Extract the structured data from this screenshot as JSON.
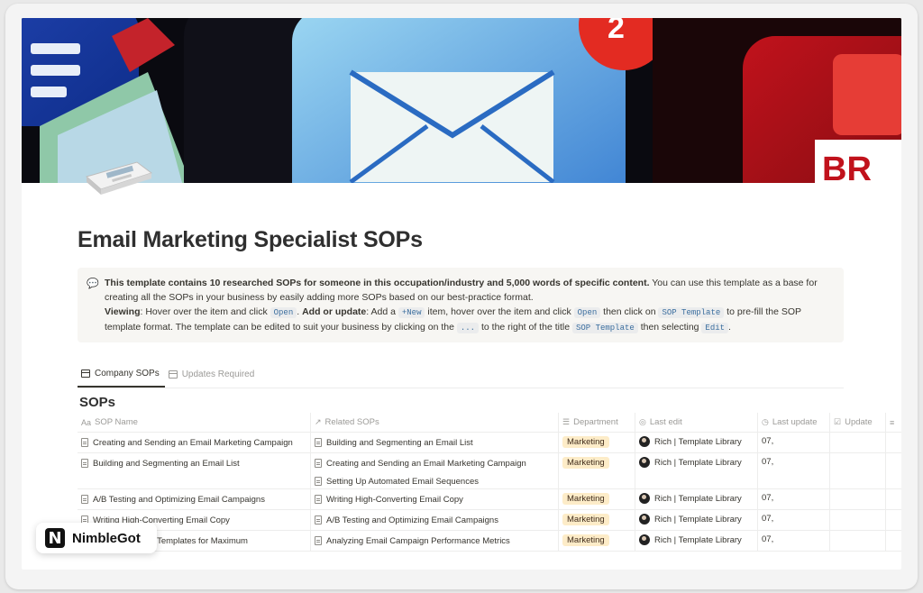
{
  "page": {
    "title": "Email Marketing Specialist SOPs"
  },
  "callout": {
    "icon": "speech-bubble-icon",
    "bold_intro": "This template contains 10 researched SOPs for someone in this occupation/industry and 5,000 words of specific content.",
    "intro_rest": " You can use this template as a base for creating all the SOPs in your business by easily adding more SOPs based on our best-practice format.",
    "viewing_label": "Viewing",
    "viewing_text": ": Hover over the item and click ",
    "open_code": "Open",
    "period1": ". ",
    "add_label": "Add or update",
    "add_text": ": Add a ",
    "new_code": "+New",
    "add_text2": " item, hover over the item and click ",
    "open_code2": "Open",
    "add_text3": " then click on ",
    "sop_template_code": "SOP Template",
    "add_text4": " to pre-fill the SOP template format. The template can be edited to suit your business by clicking on the ",
    "dots_code": "...",
    "add_text5": " to the right of the title ",
    "sop_template_code2": "SOP Template",
    "add_text6": " then selecting ",
    "edit_code": "Edit",
    "period2": "."
  },
  "tabs": [
    {
      "label": "Company SOPs",
      "active": true
    },
    {
      "label": "Updates Required",
      "active": false
    }
  ],
  "database": {
    "title": "SOPs",
    "columns": {
      "name": "SOP Name",
      "name_icon": "Aa",
      "related": "Related SOPs",
      "related_icon": "↗",
      "department": "Department",
      "department_icon": "☰",
      "last_edit": "Last edit",
      "last_edit_icon": "◎",
      "last_update": "Last update",
      "last_update_icon": "◷",
      "update": "Update",
      "update_icon": "☑",
      "more_icon": "≡"
    },
    "rows": [
      {
        "name": "Creating and Sending an Email Marketing Campaign",
        "related": [
          "Building and Segmenting an Email List"
        ],
        "department": "Marketing",
        "last_edit": "Rich | Template Library",
        "last_update": "07,"
      },
      {
        "name": "Building and Segmenting an Email List",
        "related": [
          "Creating and Sending an Email Marketing Campaign",
          "Setting Up Automated Email Sequences"
        ],
        "department": "Marketing",
        "last_edit": "Rich | Template Library",
        "last_update": "07,"
      },
      {
        "name": "A/B Testing and Optimizing Email Campaigns",
        "related": [
          "Writing High-Converting Email Copy"
        ],
        "department": "Marketing",
        "last_edit": "Rich | Template Library",
        "last_update": "07,"
      },
      {
        "name": "Writing High-Converting Email Copy",
        "related": [
          "A/B Testing and Optimizing Email Campaigns"
        ],
        "department": "Marketing",
        "last_edit": "Rich | Template Library",
        "last_update": "07,"
      },
      {
        "name": "Designing Email Templates for Maximum",
        "related": [
          "Analyzing Email Campaign Performance Metrics"
        ],
        "department": "Marketing",
        "last_edit": "Rich | Template Library",
        "last_update": "07,"
      }
    ]
  },
  "badge": {
    "logo_letter": "N",
    "text": "NimbleGot"
  },
  "colors": {
    "tag_bg": "#fdecc8",
    "code_text": "#3b6e9e",
    "callout_bg": "#f7f6f3"
  }
}
